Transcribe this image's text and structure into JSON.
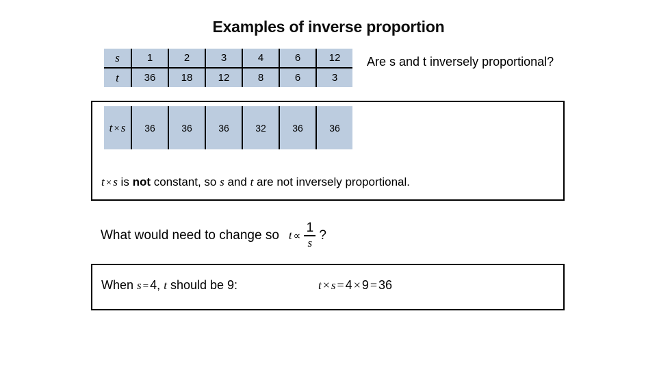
{
  "title": "Examples of inverse proportion",
  "table": {
    "row_s": {
      "label": "s",
      "values": [
        "1",
        "2",
        "3",
        "4",
        "6",
        "12"
      ]
    },
    "row_t": {
      "label": "t",
      "values": [
        "36",
        "18",
        "12",
        "8",
        "6",
        "3"
      ]
    },
    "row_product": {
      "label_t": "t",
      "label_times": "×",
      "label_s": "s",
      "values": [
        "36",
        "36",
        "36",
        "32",
        "36",
        "36"
      ]
    }
  },
  "side_question": "Are s and t inversely proportional?",
  "conclusion": {
    "math_t": "t",
    "math_times": "×",
    "math_s": "s",
    "part1": " is ",
    "emphasis": "not",
    "part2": " constant, so ",
    "var_s": "s",
    "part3": " and ",
    "var_t": "t",
    "part4": " are not inversely proportional."
  },
  "change_question": {
    "text": "What would need to change so",
    "var_t": "t",
    "prop_symbol": "∝",
    "numerator": "1",
    "denominator": "s",
    "question_mark": "?"
  },
  "answer": {
    "when": "When",
    "var_s": "s",
    "equals": "=",
    "s_value": "4",
    "comma": ",",
    "var_t": "t",
    "should_be": "should be",
    "t_value": "9",
    "colon": ":",
    "equation": {
      "t": "t",
      "times": "×",
      "s": "s",
      "eq1": "=",
      "a": "4",
      "times2": "×",
      "b": "9",
      "eq2": "=",
      "result": "36"
    }
  },
  "colors": {
    "cell_fill": "#bcccdf",
    "border": "#000000",
    "text": "#000000"
  }
}
